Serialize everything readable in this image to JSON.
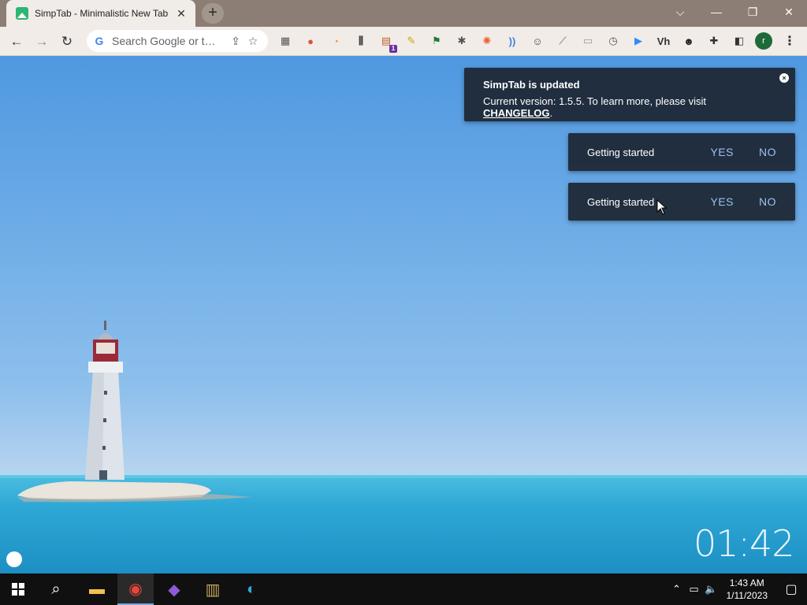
{
  "browser": {
    "tab": {
      "title": "SimpTab - Minimalistic New Tab",
      "close_glyph": "✕"
    },
    "new_tab_glyph": "+",
    "window_controls": {
      "tab_search": "⌵",
      "minimize": "—",
      "restore": "❐",
      "close": "✕"
    },
    "nav": {
      "back": "←",
      "forward": "→",
      "reload": "↻"
    },
    "omnibox": {
      "placeholder": "Search Google or t…",
      "g_logo": "G",
      "share_glyph": "⇪",
      "star_glyph": "☆"
    },
    "extensions": [
      {
        "icon": "calculator-icon",
        "glyph": "▦",
        "color": "#555555"
      },
      {
        "icon": "readwise-icon",
        "glyph": "●",
        "color": "#e0533a"
      },
      {
        "icon": "clock-orange-icon",
        "glyph": "◔",
        "color": "#f0a020"
      },
      {
        "icon": "equalizer-icon",
        "glyph": "⫼",
        "color": "#333333"
      },
      {
        "icon": "toolbox-icon",
        "glyph": "▤",
        "color": "#c06030",
        "badge": "1"
      },
      {
        "icon": "pencil-icon",
        "glyph": "✎",
        "color": "#d4a000"
      },
      {
        "icon": "runner-icon",
        "glyph": "⚑",
        "color": "#1a7a3a"
      },
      {
        "icon": "bug-icon",
        "glyph": "✱",
        "color": "#555555"
      },
      {
        "icon": "flame-icon",
        "glyph": "✺",
        "color": "#f06030"
      },
      {
        "icon": "wifi-icon",
        "glyph": "))",
        "color": "#3f7fe0"
      },
      {
        "icon": "person-icon",
        "glyph": "☺",
        "color": "#444444"
      },
      {
        "icon": "tag-icon",
        "glyph": "⟋",
        "color": "#999999"
      },
      {
        "icon": "image-icon",
        "glyph": "▭",
        "color": "#999999"
      },
      {
        "icon": "gauge-icon",
        "glyph": "◷",
        "color": "#555555"
      },
      {
        "icon": "video-icon",
        "glyph": "▶",
        "color": "#2d8cff"
      },
      {
        "icon": "vh-icon",
        "glyph": "Vh",
        "color": "#333333"
      },
      {
        "icon": "alien-icon",
        "glyph": "☻",
        "color": "#222222"
      },
      {
        "icon": "puzzle-icon",
        "glyph": "✚",
        "color": "#333333"
      },
      {
        "icon": "sidepanel-icon",
        "glyph": "◧",
        "color": "#333333"
      }
    ],
    "profile_initial": "r",
    "menu_glyph": "⋮"
  },
  "notifications": {
    "update": {
      "title": "SimpTab is updated",
      "body_prefix": "Current version: 1.5.5. To learn more, please visit ",
      "link": "CHANGELOG",
      "body_suffix": ".",
      "close_glyph": "×"
    },
    "getting_started": [
      {
        "text": "Getting started",
        "yes": "YES",
        "no": "NO"
      },
      {
        "text": "Getting started",
        "yes": "YES",
        "no": "NO"
      }
    ]
  },
  "clock": "01:42",
  "taskbar": {
    "start_icon": "windows-start-icon",
    "search_glyph": "⌕",
    "apps": [
      {
        "name": "file-explorer-icon",
        "glyph": "▬",
        "color": "#f2c14e"
      },
      {
        "name": "chrome-icon",
        "glyph": "◉",
        "color": "#e8453c",
        "active": true
      },
      {
        "name": "visual-studio-icon",
        "glyph": "◆",
        "color": "#8e5bd6"
      },
      {
        "name": "winrar-icon",
        "glyph": "▥",
        "color": "#c9a85a"
      },
      {
        "name": "edge-icon",
        "glyph": "◐",
        "color": "#2fa7d8"
      }
    ],
    "tray": {
      "chevron": "⌃",
      "network": "▭",
      "volume": "🔈"
    },
    "time": "1:43 AM",
    "date": "1/11/2023",
    "notification_glyph": "▢"
  }
}
